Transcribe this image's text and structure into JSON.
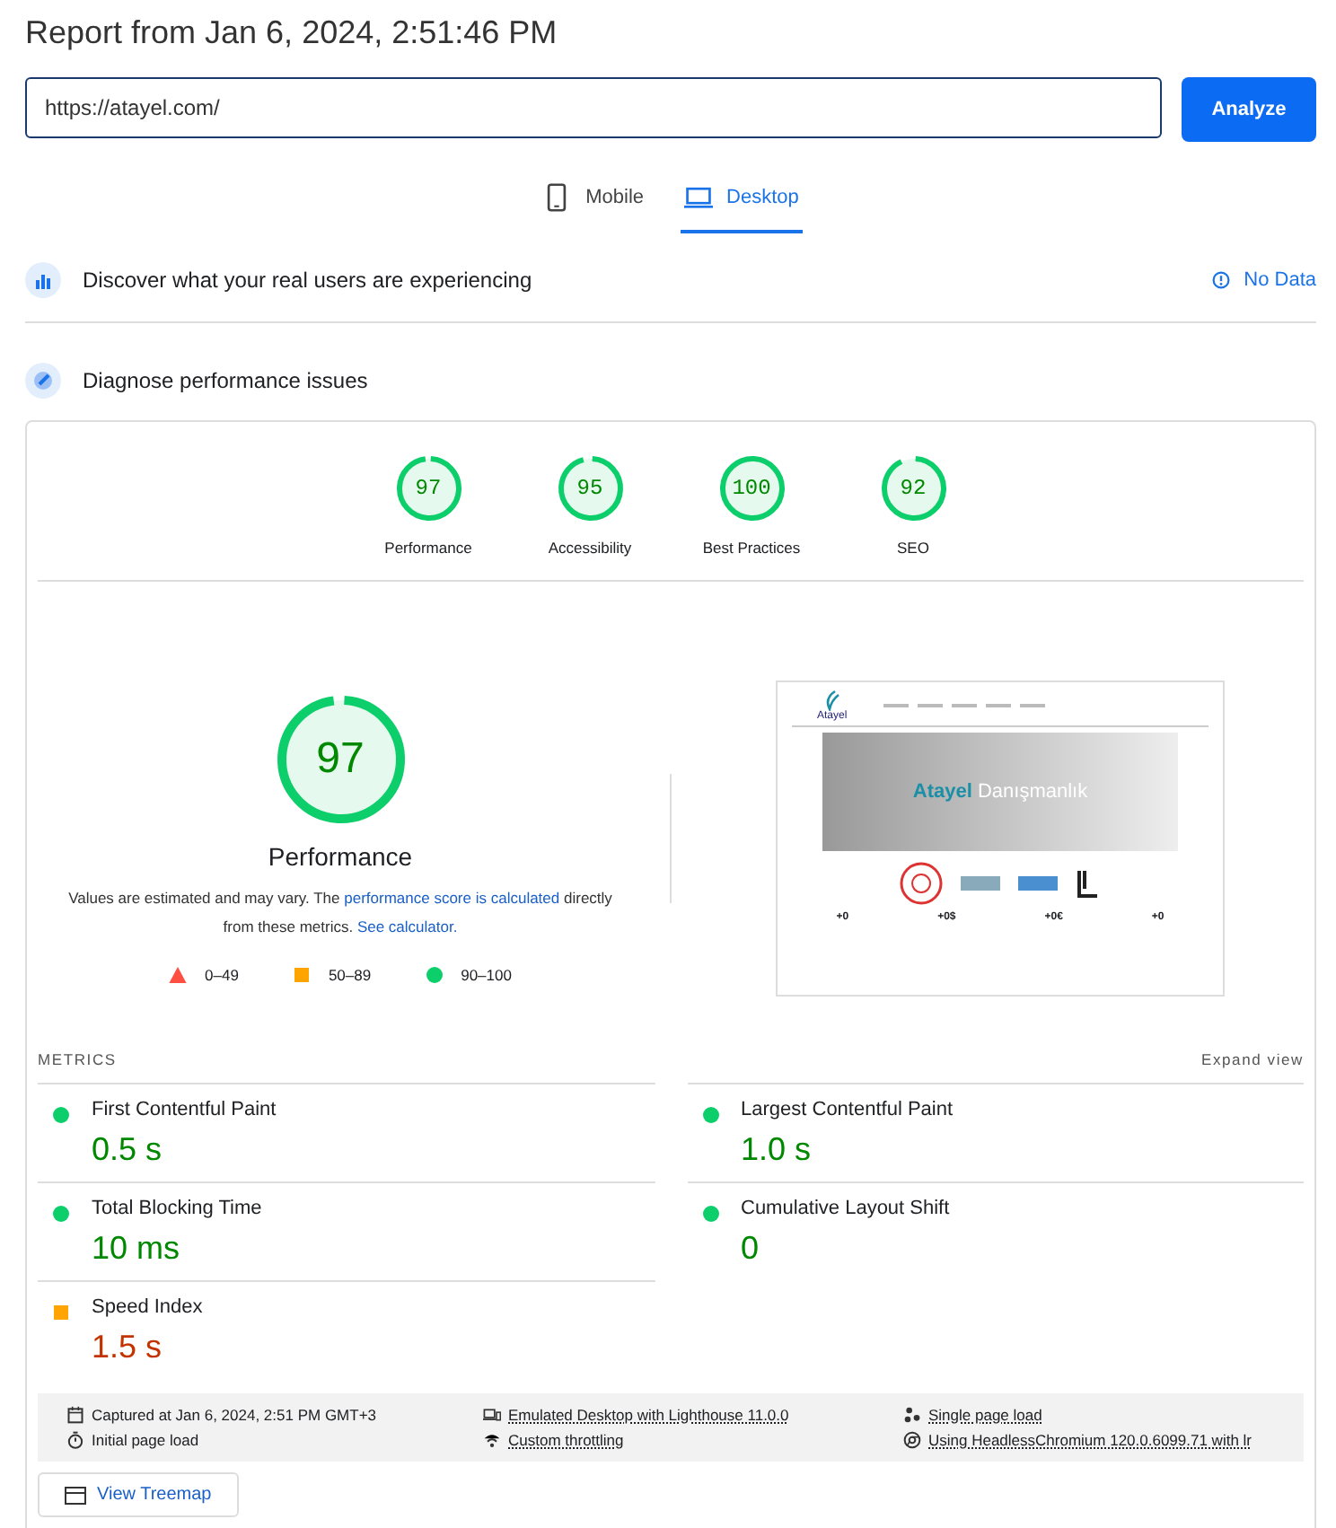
{
  "title": "Report from Jan 6, 2024, 2:51:46 PM",
  "url_field": {
    "value": "https://atayel.com/"
  },
  "analyze_button": "Analyze",
  "tabs": [
    {
      "label": "Mobile",
      "kind": "phone",
      "selected": false
    },
    {
      "label": "Desktop",
      "kind": "laptop",
      "selected": true
    }
  ],
  "field_section": {
    "heading": "Discover what your real users are experiencing",
    "status": "No Data"
  },
  "lab_section": {
    "heading": "Diagnose performance issues"
  },
  "category_gauges": [
    {
      "score": "97",
      "label": "Performance"
    },
    {
      "score": "95",
      "label": "Accessibility"
    },
    {
      "score": "100",
      "label": "Best Practices"
    },
    {
      "score": "92",
      "label": "SEO"
    }
  ],
  "main_gauge": {
    "score": "97",
    "label": "Performance"
  },
  "note": {
    "before": "Values are estimated and may vary. The ",
    "link1": "performance score is calculated",
    "middle": " directly from these metrics. ",
    "link2": "See calculator."
  },
  "legend": [
    {
      "kind": "fail",
      "range": "0–49"
    },
    {
      "kind": "average",
      "range": "50–89"
    },
    {
      "kind": "pass",
      "range": "90–100"
    }
  ],
  "preview": {
    "logo": "Atayel",
    "banner_brand": "Atayel",
    "banner_word": "Danışmanlık",
    "stats": [
      "+0",
      "+0$",
      "+0€",
      "+0"
    ]
  },
  "metrics_heading": "METRICS",
  "expand_view": "Expand view",
  "metrics": [
    {
      "name": "First Contentful Paint",
      "value": "0.5 s",
      "kind": "pass"
    },
    {
      "name": "Largest Contentful Paint",
      "value": "1.0 s",
      "kind": "pass"
    },
    {
      "name": "Total Blocking Time",
      "value": "10 ms",
      "kind": "pass"
    },
    {
      "name": "Cumulative Layout Shift",
      "value": "0",
      "kind": "pass"
    },
    {
      "name": "Speed Index",
      "value": "1.5 s",
      "kind": "average"
    }
  ],
  "run_info": [
    {
      "kind": "calendar",
      "text": "Captured at Jan 6, 2024, 2:51 PM GMT+3",
      "underlined": false
    },
    {
      "kind": "devices",
      "text": "Emulated Desktop with Lighthouse 11.0.0",
      "underlined": true
    },
    {
      "kind": "dots",
      "text": "Single page load",
      "underlined": true
    },
    {
      "kind": "timer",
      "text": "Initial page load",
      "underlined": false
    },
    {
      "kind": "wifi",
      "text": "Custom throttling",
      "underlined": true
    },
    {
      "kind": "browser",
      "text": "Using HeadlessChromium 120.0.6099.71 with lr",
      "underlined": true
    }
  ],
  "treemap_button": "View Treemap"
}
